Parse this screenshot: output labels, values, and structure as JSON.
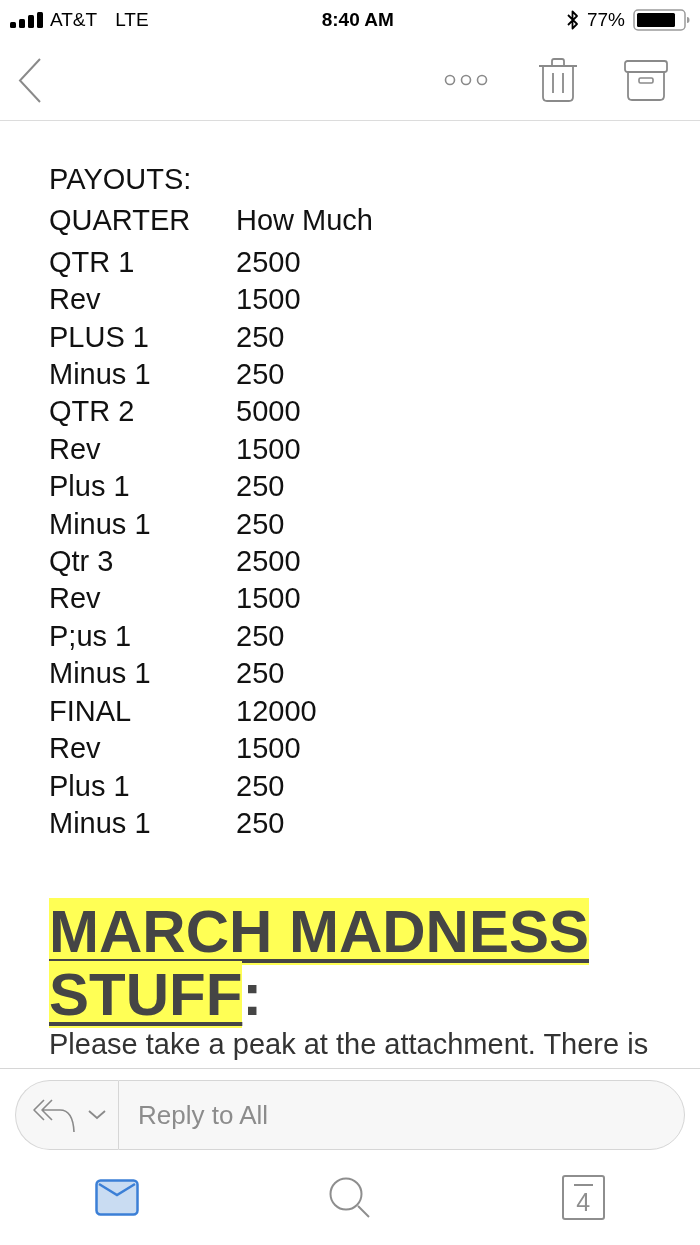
{
  "status_bar": {
    "carrier": "AT&T",
    "network": "LTE",
    "time": "8:40 AM",
    "battery": "77%"
  },
  "message": {
    "heading": "PAYOUTS:",
    "table": {
      "columns": [
        "QUARTER",
        "How Much"
      ],
      "rows": [
        [
          "QTR 1",
          "2500"
        ],
        [
          "Rev",
          "1500"
        ],
        [
          "PLUS 1",
          "250"
        ],
        [
          "Minus 1",
          "250"
        ],
        [
          "QTR 2",
          "5000"
        ],
        [
          "Rev",
          "1500"
        ],
        [
          "Plus 1",
          "250"
        ],
        [
          "Minus 1",
          "250"
        ],
        [
          "Qtr 3",
          "2500"
        ],
        [
          "Rev",
          "1500"
        ],
        [
          "P;us 1",
          "250"
        ],
        [
          "Minus 1",
          "250"
        ],
        [
          "FINAL",
          "12000"
        ],
        [
          "Rev",
          "1500"
        ],
        [
          "Plus 1",
          "250"
        ],
        [
          "Minus 1",
          "250"
        ]
      ]
    },
    "section_title": {
      "text": "MARCH MADNESS STUFF",
      "suffix": ":"
    },
    "body": "Please take a peak at the attachment. There is"
  },
  "reply_bar": {
    "placeholder": "Reply to All"
  },
  "tab_bar": {
    "tabs": [
      {
        "kind": "mail",
        "selected": true
      },
      {
        "kind": "search",
        "selected": false
      },
      {
        "kind": "calendar",
        "label": "4",
        "selected": false
      }
    ]
  }
}
